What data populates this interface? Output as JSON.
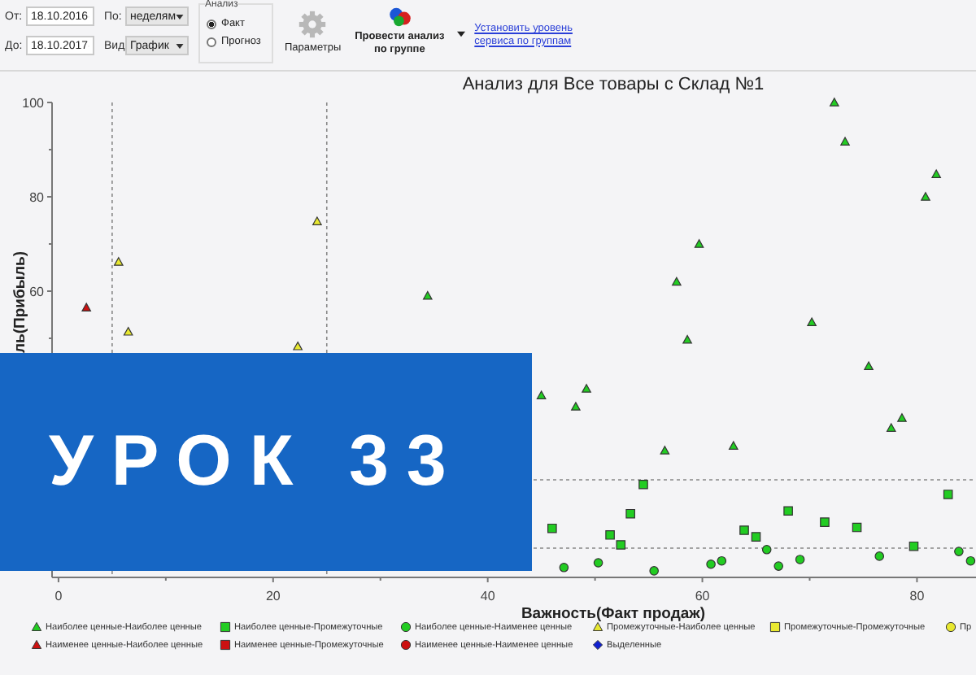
{
  "toolbar": {
    "date_from": {
      "label": "От:",
      "value": "18.10.2016"
    },
    "date_to": {
      "label": "До:",
      "value": "18.10.2017"
    },
    "period": {
      "label": "По:",
      "value": "неделям"
    },
    "view": {
      "label": "Вид",
      "value": "График"
    },
    "analysis": {
      "title": "Анализ",
      "options": [
        {
          "label": "Факт",
          "selected": true
        },
        {
          "label": "Прогноз",
          "selected": false
        }
      ]
    },
    "settings_button": "Параметры",
    "analyze_button": "Провести анализ по группе",
    "service_link": "Установить уровень сервиса по группам"
  },
  "chart": {
    "chart_data": {
      "type": "scatter",
      "title": "Анализ для Все товары с Склад №1",
      "xlabel": "Важность(Факт продаж)",
      "ylabel": "ль(Прибыль)",
      "xlim": [
        -0.6,
        85.5
      ],
      "ylim": [
        -0.7,
        100
      ],
      "legend": "bottom",
      "xticks": [
        0,
        20,
        40,
        60,
        80
      ],
      "yticks": [
        60,
        80,
        100
      ],
      "series": [
        {
          "name": "Наиболее ценные-Наиболее ценные",
          "marker": "triangle",
          "color": "#22cc22",
          "x": [
            72.3,
            73.3,
            81.8,
            80.8,
            59.7,
            57.6,
            58.6,
            70.2,
            75.5,
            78.6,
            77.6,
            62.9,
            56.5,
            49.2,
            48.2,
            45,
            34.4
          ],
          "values": [
            100,
            91.7,
            84.8,
            80,
            70,
            62,
            49.7,
            53.4,
            44.1,
            33.1,
            31,
            27.2,
            26.2,
            39.3,
            35.5,
            37.9,
            59
          ]
        },
        {
          "name": "Наиболее ценные-Промежуточные",
          "marker": "square",
          "color": "#22cc22",
          "x": [
            46,
            54.5,
            53.3,
            51.4,
            52.4,
            68,
            63.9,
            65,
            71.4,
            74.4,
            79.7,
            82.9
          ],
          "values": [
            9.7,
            19,
            12.8,
            8.3,
            6.2,
            13.4,
            9.3,
            7.9,
            11,
            9.9,
            5.9,
            16.9
          ]
        },
        {
          "name": "Наиболее ценные-Наименее ценные",
          "marker": "circle",
          "color": "#22cc22",
          "x": [
            47.1,
            50.3,
            55.5,
            60.8,
            61.8,
            66,
            67.1,
            69.1,
            76.5,
            83.9,
            85
          ],
          "values": [
            1.4,
            2.4,
            0.7,
            2.1,
            2.8,
            5.2,
            1.7,
            3.1,
            3.8,
            4.8,
            2.8
          ]
        },
        {
          "name": "Промежуточные-Наиболее ценные",
          "marker": "triangle",
          "color": "#e8e830",
          "x": [
            5.6,
            6.5,
            22.3,
            24.1
          ],
          "values": [
            66.2,
            51.4,
            48.3,
            74.8
          ]
        },
        {
          "name": "Промежуточные-Промежуточные",
          "marker": "square",
          "color": "#e8e830"
        },
        {
          "name": "Пр",
          "marker": "circle",
          "color": "#e8e830"
        },
        {
          "name": "Наименее ценные-Наиболее ценные",
          "marker": "triangle",
          "color": "#cc1111",
          "x": [
            2.6
          ],
          "values": [
            56.5
          ]
        },
        {
          "name": "Наименее ценные-Промежуточные",
          "marker": "square",
          "color": "#cc1111"
        },
        {
          "name": "Наименее ценные-Наименее ценные",
          "marker": "circle",
          "color": "#cc1111"
        },
        {
          "name": "Выделенные",
          "marker": "diamond",
          "color": "#1020d0"
        }
      ]
    }
  },
  "banner": "УРОК 33"
}
